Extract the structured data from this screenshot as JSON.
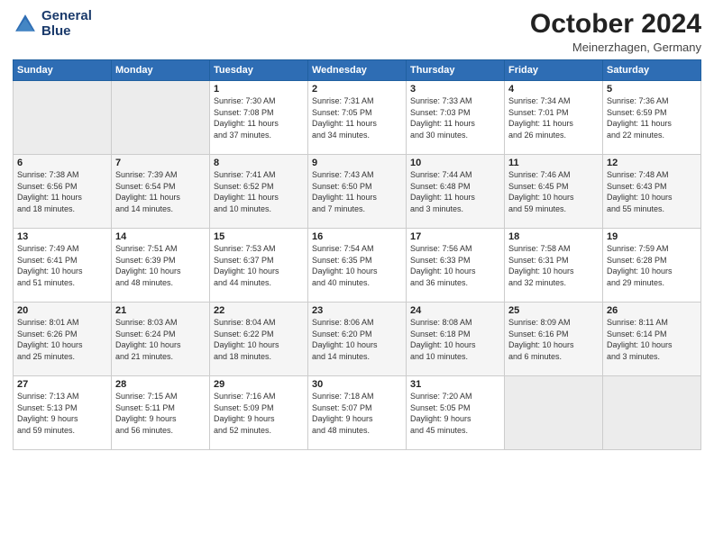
{
  "logo": {
    "line1": "General",
    "line2": "Blue"
  },
  "title": {
    "month_year": "October 2024",
    "location": "Meinerzhagen, Germany"
  },
  "days_of_week": [
    "Sunday",
    "Monday",
    "Tuesday",
    "Wednesday",
    "Thursday",
    "Friday",
    "Saturday"
  ],
  "weeks": [
    [
      {
        "day": "",
        "info": ""
      },
      {
        "day": "",
        "info": ""
      },
      {
        "day": "1",
        "info": "Sunrise: 7:30 AM\nSunset: 7:08 PM\nDaylight: 11 hours\nand 37 minutes."
      },
      {
        "day": "2",
        "info": "Sunrise: 7:31 AM\nSunset: 7:05 PM\nDaylight: 11 hours\nand 34 minutes."
      },
      {
        "day": "3",
        "info": "Sunrise: 7:33 AM\nSunset: 7:03 PM\nDaylight: 11 hours\nand 30 minutes."
      },
      {
        "day": "4",
        "info": "Sunrise: 7:34 AM\nSunset: 7:01 PM\nDaylight: 11 hours\nand 26 minutes."
      },
      {
        "day": "5",
        "info": "Sunrise: 7:36 AM\nSunset: 6:59 PM\nDaylight: 11 hours\nand 22 minutes."
      }
    ],
    [
      {
        "day": "6",
        "info": "Sunrise: 7:38 AM\nSunset: 6:56 PM\nDaylight: 11 hours\nand 18 minutes."
      },
      {
        "day": "7",
        "info": "Sunrise: 7:39 AM\nSunset: 6:54 PM\nDaylight: 11 hours\nand 14 minutes."
      },
      {
        "day": "8",
        "info": "Sunrise: 7:41 AM\nSunset: 6:52 PM\nDaylight: 11 hours\nand 10 minutes."
      },
      {
        "day": "9",
        "info": "Sunrise: 7:43 AM\nSunset: 6:50 PM\nDaylight: 11 hours\nand 7 minutes."
      },
      {
        "day": "10",
        "info": "Sunrise: 7:44 AM\nSunset: 6:48 PM\nDaylight: 11 hours\nand 3 minutes."
      },
      {
        "day": "11",
        "info": "Sunrise: 7:46 AM\nSunset: 6:45 PM\nDaylight: 10 hours\nand 59 minutes."
      },
      {
        "day": "12",
        "info": "Sunrise: 7:48 AM\nSunset: 6:43 PM\nDaylight: 10 hours\nand 55 minutes."
      }
    ],
    [
      {
        "day": "13",
        "info": "Sunrise: 7:49 AM\nSunset: 6:41 PM\nDaylight: 10 hours\nand 51 minutes."
      },
      {
        "day": "14",
        "info": "Sunrise: 7:51 AM\nSunset: 6:39 PM\nDaylight: 10 hours\nand 48 minutes."
      },
      {
        "day": "15",
        "info": "Sunrise: 7:53 AM\nSunset: 6:37 PM\nDaylight: 10 hours\nand 44 minutes."
      },
      {
        "day": "16",
        "info": "Sunrise: 7:54 AM\nSunset: 6:35 PM\nDaylight: 10 hours\nand 40 minutes."
      },
      {
        "day": "17",
        "info": "Sunrise: 7:56 AM\nSunset: 6:33 PM\nDaylight: 10 hours\nand 36 minutes."
      },
      {
        "day": "18",
        "info": "Sunrise: 7:58 AM\nSunset: 6:31 PM\nDaylight: 10 hours\nand 32 minutes."
      },
      {
        "day": "19",
        "info": "Sunrise: 7:59 AM\nSunset: 6:28 PM\nDaylight: 10 hours\nand 29 minutes."
      }
    ],
    [
      {
        "day": "20",
        "info": "Sunrise: 8:01 AM\nSunset: 6:26 PM\nDaylight: 10 hours\nand 25 minutes."
      },
      {
        "day": "21",
        "info": "Sunrise: 8:03 AM\nSunset: 6:24 PM\nDaylight: 10 hours\nand 21 minutes."
      },
      {
        "day": "22",
        "info": "Sunrise: 8:04 AM\nSunset: 6:22 PM\nDaylight: 10 hours\nand 18 minutes."
      },
      {
        "day": "23",
        "info": "Sunrise: 8:06 AM\nSunset: 6:20 PM\nDaylight: 10 hours\nand 14 minutes."
      },
      {
        "day": "24",
        "info": "Sunrise: 8:08 AM\nSunset: 6:18 PM\nDaylight: 10 hours\nand 10 minutes."
      },
      {
        "day": "25",
        "info": "Sunrise: 8:09 AM\nSunset: 6:16 PM\nDaylight: 10 hours\nand 6 minutes."
      },
      {
        "day": "26",
        "info": "Sunrise: 8:11 AM\nSunset: 6:14 PM\nDaylight: 10 hours\nand 3 minutes."
      }
    ],
    [
      {
        "day": "27",
        "info": "Sunrise: 7:13 AM\nSunset: 5:13 PM\nDaylight: 9 hours\nand 59 minutes."
      },
      {
        "day": "28",
        "info": "Sunrise: 7:15 AM\nSunset: 5:11 PM\nDaylight: 9 hours\nand 56 minutes."
      },
      {
        "day": "29",
        "info": "Sunrise: 7:16 AM\nSunset: 5:09 PM\nDaylight: 9 hours\nand 52 minutes."
      },
      {
        "day": "30",
        "info": "Sunrise: 7:18 AM\nSunset: 5:07 PM\nDaylight: 9 hours\nand 48 minutes."
      },
      {
        "day": "31",
        "info": "Sunrise: 7:20 AM\nSunset: 5:05 PM\nDaylight: 9 hours\nand 45 minutes."
      },
      {
        "day": "",
        "info": ""
      },
      {
        "day": "",
        "info": ""
      }
    ]
  ]
}
